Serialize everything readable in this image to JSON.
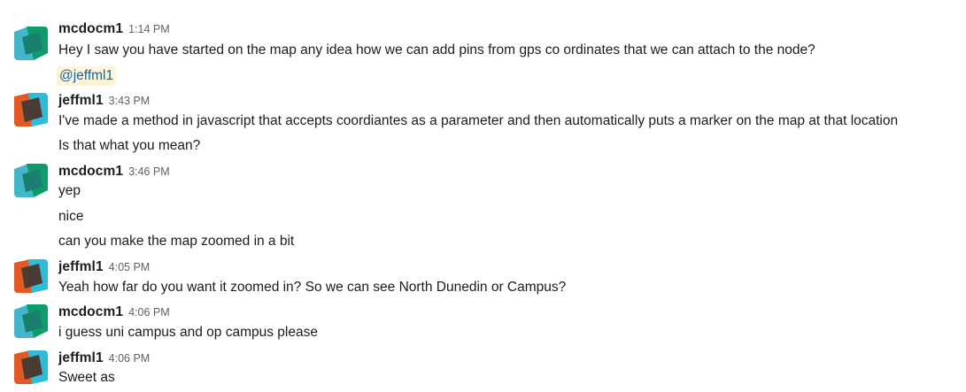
{
  "colors": {
    "background": "#ffffff",
    "text": "#1d1c1d",
    "timestamp": "#616061",
    "mention_text": "#1264a3",
    "mention_bg": "#fff5d6",
    "avatar_mcdocm1_left": "#44b6c9",
    "avatar_mcdocm1_right": "#0f9c68",
    "avatar_jeffml1_left": "#e15a26",
    "avatar_jeffml1_right": "#2fbcd8"
  },
  "messages": [
    {
      "author": "mcdocm1",
      "avatar_icon": "teal-green-diamond-avatar",
      "time": "1:14 PM",
      "lines": [
        "Hey I saw you have started on the map any idea how we can add pins from gps co ordinates that we can attach to the node?"
      ],
      "mention": "@jeffml1"
    },
    {
      "author": "jeffml1",
      "avatar_icon": "orange-cyan-diamond-avatar",
      "time": "3:43 PM",
      "lines": [
        "I've made a method in javascript that accepts coordiantes as a parameter and then automatically puts a marker on the map at that location",
        "Is that what you mean?"
      ]
    },
    {
      "author": "mcdocm1",
      "avatar_icon": "teal-green-diamond-avatar",
      "time": "3:46 PM",
      "lines": [
        "yep",
        "nice",
        "can you make the map zoomed in a bit"
      ]
    },
    {
      "author": "jeffml1",
      "avatar_icon": "orange-cyan-diamond-avatar",
      "time": "4:05 PM",
      "lines": [
        "Yeah how far do you want it zoomed in? So we can see North Dunedin or Campus?"
      ]
    },
    {
      "author": "mcdocm1",
      "avatar_icon": "teal-green-diamond-avatar",
      "time": "4:06 PM",
      "lines": [
        "i guess uni campus and op campus please"
      ]
    },
    {
      "author": "jeffml1",
      "avatar_icon": "orange-cyan-diamond-avatar",
      "time": "4:06 PM",
      "lines": [
        "Sweet as"
      ]
    }
  ]
}
